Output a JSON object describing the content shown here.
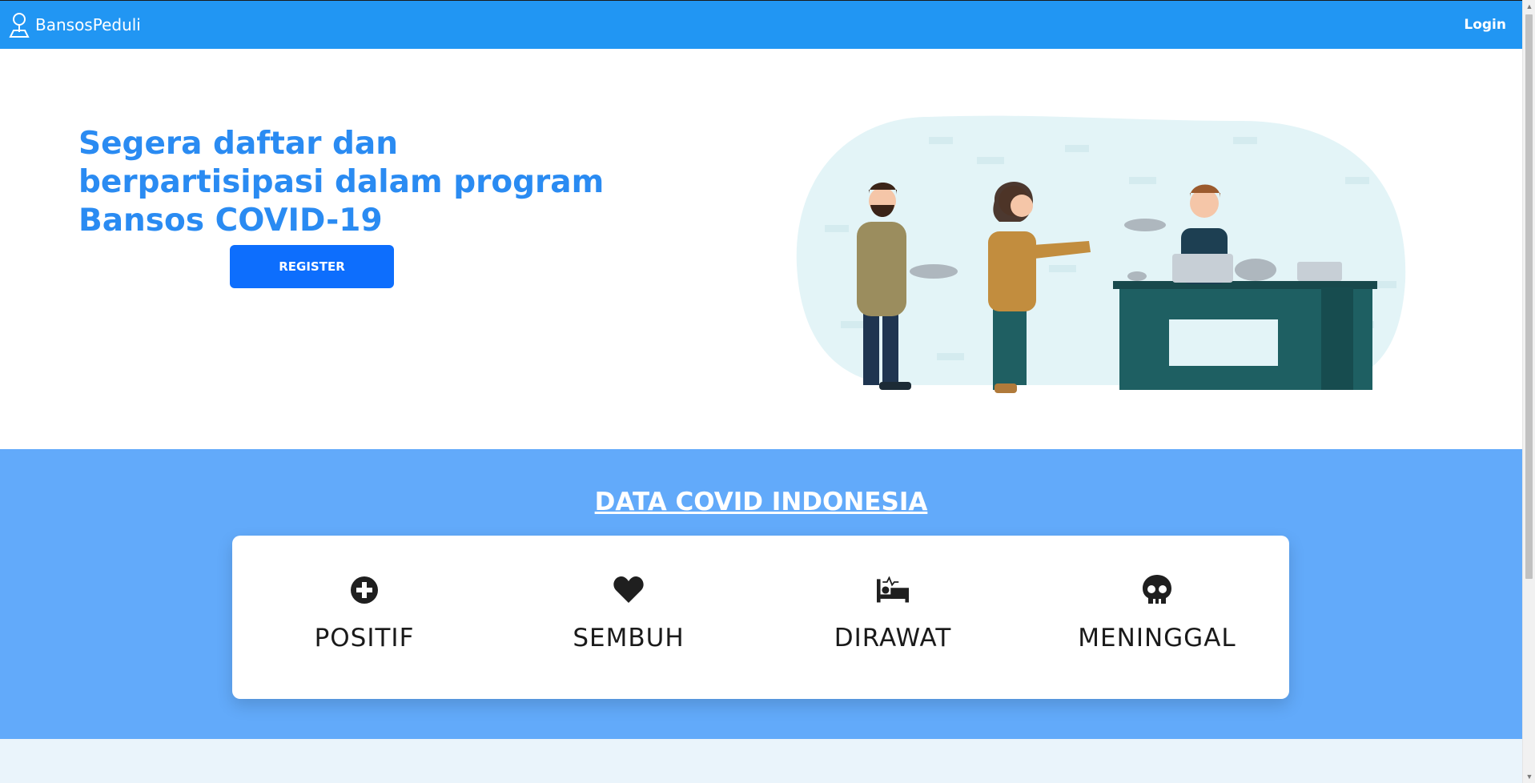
{
  "navbar": {
    "brand": "BansosPeduli",
    "login": "Login"
  },
  "hero": {
    "title": "Segera daftar dan berpartisipasi dalam program Bansos COVID-19",
    "register_label": "REGISTER"
  },
  "covid": {
    "title": "DATA COVID INDONESIA",
    "stats": [
      {
        "label": "POSITIF",
        "icon": "plus-circle-icon"
      },
      {
        "label": "SEMBUH",
        "icon": "heart-icon"
      },
      {
        "label": "DIRAWAT",
        "icon": "bed-pulse-icon"
      },
      {
        "label": "MENINGGAL",
        "icon": "skull-icon"
      }
    ]
  },
  "colors": {
    "navbar": "#2196f3",
    "hero_title": "#2a8bf2",
    "register_button": "#0d6efd",
    "covid_bg": "#62aafa",
    "bottom_bg": "#eaf4fb"
  }
}
